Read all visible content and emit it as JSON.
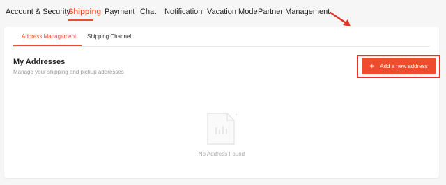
{
  "top_tabs": [
    {
      "label": "Account & Security"
    },
    {
      "label": "Shipping",
      "active": true
    },
    {
      "label": "Payment"
    },
    {
      "label": "Chat"
    },
    {
      "label": "Notification"
    },
    {
      "label": "Vacation Mode"
    },
    {
      "label": "Partner Management"
    }
  ],
  "sub_tabs": [
    {
      "label": "Address Management",
      "active": true
    },
    {
      "label": "Shipping Channel"
    }
  ],
  "section": {
    "title": "My Addresses",
    "subtitle": "Manage your shipping and pickup addresses"
  },
  "add_button": {
    "icon": "plus-icon",
    "label": "Add a new address"
  },
  "empty_state": {
    "icon": "empty-document-icon",
    "text": "No Address Found"
  },
  "colors": {
    "accent": "#ee4d2d",
    "annotation": "#e53224"
  }
}
